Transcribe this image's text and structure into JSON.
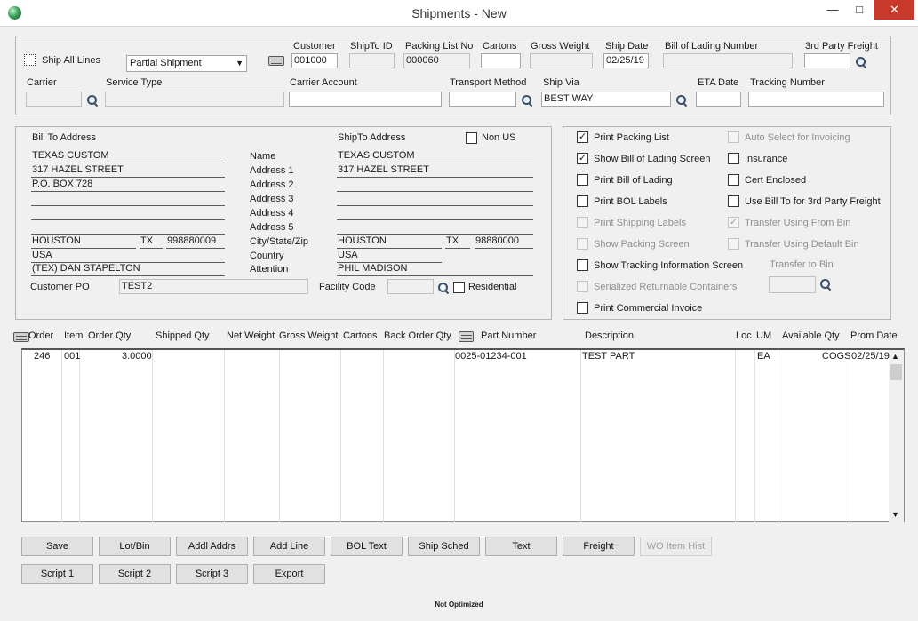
{
  "window": {
    "title": "Shipments - New",
    "minimize": "—",
    "maximize": "□",
    "close": "✕"
  },
  "header": {
    "ship_all_lines_label": "Ship All Lines",
    "shipment_type": "Partial Shipment",
    "customer_label": "Customer",
    "customer_value": "001000",
    "shipto_id_label": "ShipTo ID",
    "shipto_id_value": "",
    "packing_list_label": "Packing List No",
    "packing_list_value": "000060",
    "cartons_label": "Cartons",
    "cartons_value": "",
    "gross_weight_label": "Gross Weight",
    "gross_weight_value": "",
    "ship_date_label": "Ship Date",
    "ship_date_value": "02/25/19",
    "bol_number_label": "Bill of Lading Number",
    "bol_number_value": "",
    "third_party_label": "3rd Party Freight",
    "third_party_value": "",
    "carrier_label": "Carrier",
    "carrier_value": "",
    "service_type_label": "Service Type",
    "service_type_value": "",
    "carrier_account_label": "Carrier Account",
    "carrier_account_value": "",
    "transport_method_label": "Transport Method",
    "transport_method_value": "",
    "ship_via_label": "Ship Via",
    "ship_via_value": "BEST WAY",
    "eta_date_label": "ETA Date",
    "eta_date_value": "",
    "tracking_label": "Tracking Number",
    "tracking_value": ""
  },
  "address": {
    "bill_to_label": "Bill To Address",
    "shipto_label": "ShipTo Address",
    "non_us_label": "Non US",
    "bill_lines": [
      "TEXAS CUSTOM",
      "317 HAZEL STREET",
      "P.O. BOX 728",
      "",
      "",
      ""
    ],
    "bill_city": "HOUSTON",
    "bill_state": "TX",
    "bill_zip": "998880009",
    "bill_country": "USA",
    "bill_attention": "(TEX) DAN STAPELTON",
    "row_labels": [
      "Name",
      "Address 1",
      "Address 2",
      "Address 3",
      "Address 4",
      "Address 5",
      "City/State/Zip",
      "Country",
      "Attention"
    ],
    "ship_lines": [
      "TEXAS CUSTOM",
      "317 HAZEL STREET",
      "",
      "",
      "",
      ""
    ],
    "ship_city": "HOUSTON",
    "ship_state": "TX",
    "ship_zip": "98880000",
    "ship_country": "USA",
    "ship_attention": "PHIL MADISON",
    "customer_po_label": "Customer PO",
    "customer_po_value": "TEST2",
    "facility_code_label": "Facility Code",
    "facility_code_value": "",
    "residential_label": "Residential"
  },
  "options": {
    "left": [
      {
        "label": "Print Packing List",
        "checked": true,
        "enabled": true
      },
      {
        "label": "Show Bill of Lading Screen",
        "checked": true,
        "enabled": true
      },
      {
        "label": "Print Bill of Lading",
        "checked": false,
        "enabled": true
      },
      {
        "label": "Print BOL Labels",
        "checked": false,
        "enabled": true
      },
      {
        "label": "Print Shipping Labels",
        "checked": false,
        "enabled": false
      },
      {
        "label": "Show Packing Screen",
        "checked": false,
        "enabled": false
      },
      {
        "label": "Show Tracking Information Screen",
        "checked": false,
        "enabled": true
      },
      {
        "label": "Serialized Returnable Containers",
        "checked": false,
        "enabled": false
      },
      {
        "label": "Print Commercial Invoice",
        "checked": false,
        "enabled": true
      }
    ],
    "right": [
      {
        "label": "Auto Select for Invoicing",
        "checked": false,
        "enabled": false
      },
      {
        "label": "Insurance",
        "checked": false,
        "enabled": true
      },
      {
        "label": "Cert Enclosed",
        "checked": false,
        "enabled": true
      },
      {
        "label": "Use Bill To for 3rd Party Freight",
        "checked": false,
        "enabled": true
      },
      {
        "label": "Transfer Using From Bin",
        "checked": true,
        "enabled": false
      },
      {
        "label": "Transfer Using Default Bin",
        "checked": false,
        "enabled": false
      }
    ],
    "transfer_to_bin_label": "Transfer to Bin",
    "transfer_to_bin_value": ""
  },
  "grid": {
    "columns": [
      "Order",
      "Item",
      "Order Qty",
      "Shipped Qty",
      "Net Weight",
      "Gross Weight",
      "Cartons",
      "Back Order Qty",
      "Part Number",
      "Description",
      "Loc",
      "UM",
      "Available Qty",
      "Prom Date"
    ],
    "rows": [
      {
        "order": "246",
        "item": "001",
        "order_qty": "3.0000",
        "shipped_qty": "",
        "net_weight": "",
        "gross_weight": "",
        "cartons": "",
        "back_order_qty": "",
        "part_number": "0025-01234-001",
        "description": "TEST PART",
        "loc": "",
        "um": "EA",
        "available_qty": "COGS",
        "prom_date": "02/25/19"
      }
    ]
  },
  "buttons": {
    "row1": [
      "Save",
      "Lot/Bin",
      "Addl Addrs",
      "Add Line",
      "BOL Text",
      "Ship Sched",
      "Text",
      "Freight",
      "WO Item Hist"
    ],
    "row2": [
      "Script 1",
      "Script 2",
      "Script 3",
      "Export"
    ]
  },
  "status": "Not Optimized"
}
